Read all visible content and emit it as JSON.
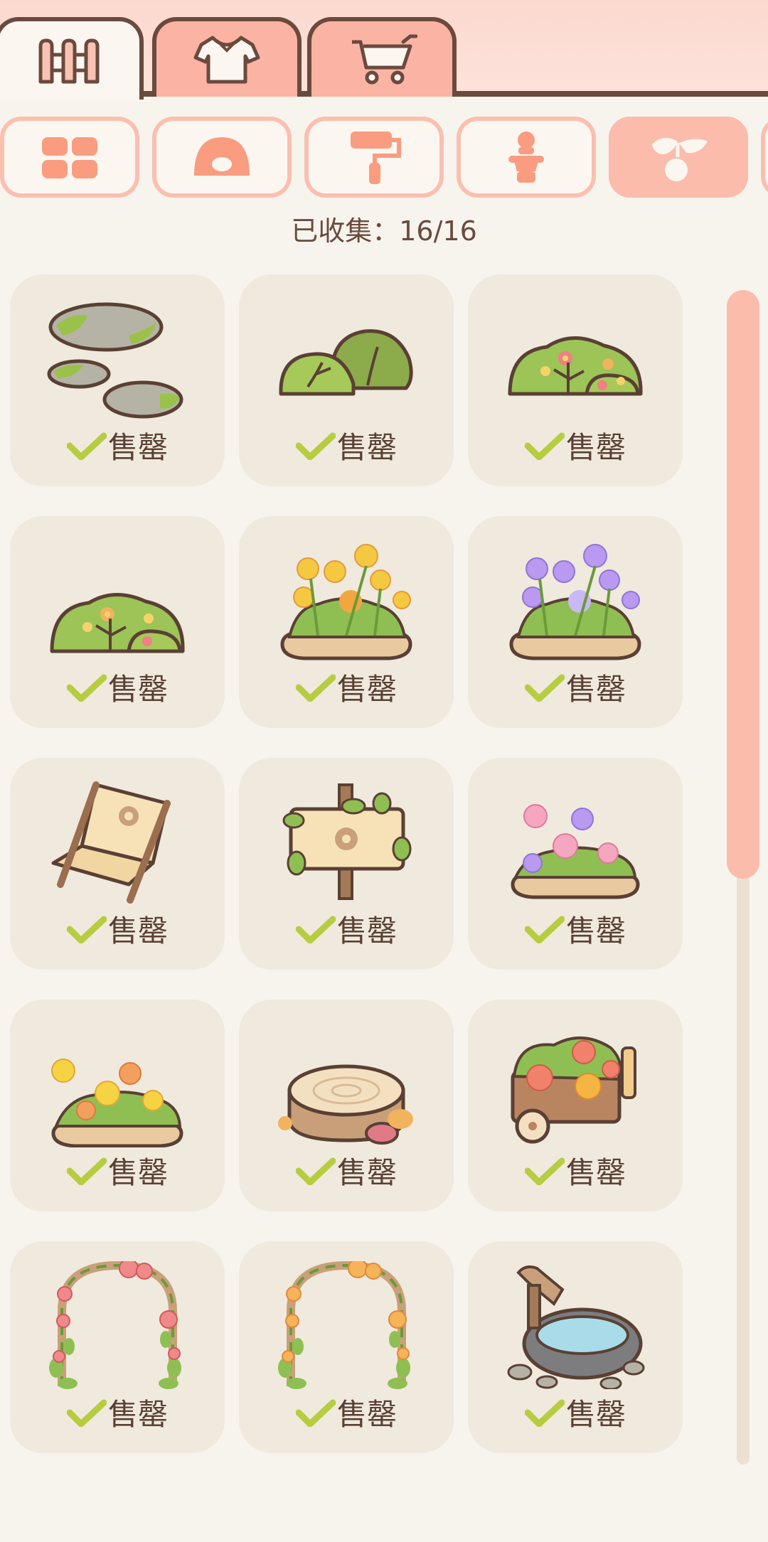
{
  "top_tabs": [
    {
      "name": "fence",
      "icon": "fence-icon",
      "active": true
    },
    {
      "name": "clothes",
      "icon": "shirt-icon",
      "active": false
    },
    {
      "name": "shop",
      "icon": "cart-icon",
      "active": false
    }
  ],
  "categories": [
    {
      "icon": "grid-icon",
      "active": false
    },
    {
      "icon": "rug-icon",
      "active": false
    },
    {
      "icon": "paint-roller-icon",
      "active": false
    },
    {
      "icon": "figure-icon",
      "active": false
    },
    {
      "icon": "plant-icon",
      "active": true
    }
  ],
  "collected_text": "已收集：16/16",
  "items": [
    {
      "art": "stepping-stones",
      "status": "售罄"
    },
    {
      "art": "green-bush",
      "status": "售罄"
    },
    {
      "art": "flower-bush",
      "status": "售罄"
    },
    {
      "art": "small-flower-bush",
      "status": "售罄"
    },
    {
      "art": "yellow-flower-bed",
      "status": "售罄"
    },
    {
      "art": "purple-flower-bed",
      "status": "售罄"
    },
    {
      "art": "wooden-chair",
      "status": "售罄"
    },
    {
      "art": "vine-signboard",
      "status": "售罄"
    },
    {
      "art": "pink-flower-bed",
      "status": "售罄"
    },
    {
      "art": "orange-flower-bed",
      "status": "售罄"
    },
    {
      "art": "tree-stump",
      "status": "售罄"
    },
    {
      "art": "flower-cart",
      "status": "售罄"
    },
    {
      "art": "rose-arch",
      "status": "售罄"
    },
    {
      "art": "orange-flower-arch",
      "status": "售罄"
    },
    {
      "art": "stone-water-basin",
      "status": "售罄"
    }
  ],
  "colors": {
    "accent": "#fbbcac",
    "border": "#6b4a3e",
    "card": "#f0e9de",
    "check": "#b8cc40"
  }
}
